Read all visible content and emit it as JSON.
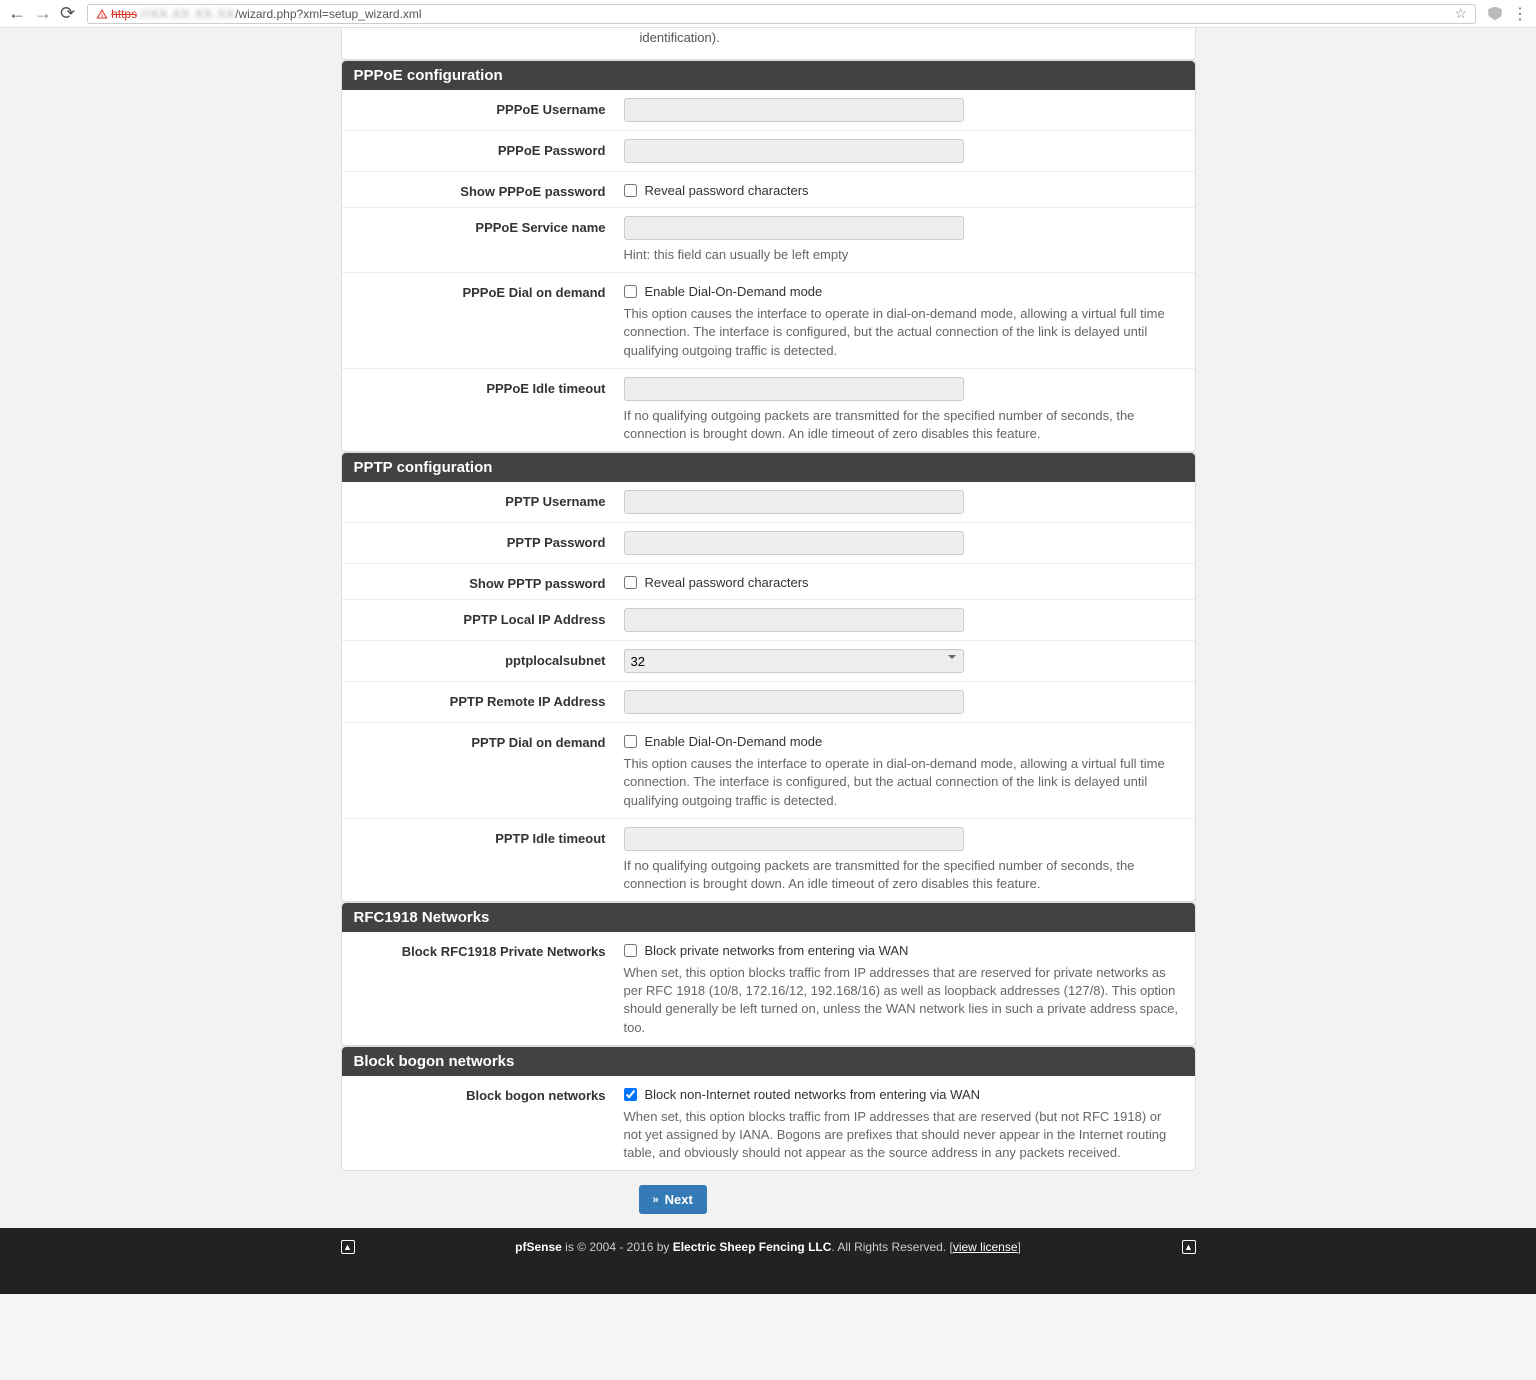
{
  "browser": {
    "url_prefix": "https",
    "url_host_blur": "://XX.XX.XX.XX",
    "url_path": "/wizard.php?xml=setup_wizard.xml"
  },
  "top_truncated": "identification).",
  "sections": {
    "pppoe": {
      "title": "PPPoE configuration",
      "username_label": "PPPoE Username",
      "password_label": "PPPoE Password",
      "show_pw_label": "Show PPPoE password",
      "show_pw_check": "Reveal password characters",
      "service_label": "PPPoE Service name",
      "service_hint": "Hint: this field can usually be left empty",
      "dial_label": "PPPoE Dial on demand",
      "dial_check": "Enable Dial-On-Demand mode",
      "dial_help": "This option causes the interface to operate in dial-on-demand mode, allowing a virtual full time connection. The interface is configured, but the actual connection of the link is delayed until qualifying outgoing traffic is detected.",
      "idle_label": "PPPoE Idle timeout",
      "idle_help": "If no qualifying outgoing packets are transmitted for the specified number of seconds, the connection is brought down. An idle timeout of zero disables this feature."
    },
    "pptp": {
      "title": "PPTP configuration",
      "username_label": "PPTP Username",
      "password_label": "PPTP Password",
      "show_pw_label": "Show PPTP password",
      "show_pw_check": "Reveal password characters",
      "localip_label": "PPTP Local IP Address",
      "subnet_label": "pptplocalsubnet",
      "subnet_value": "32",
      "remoteip_label": "PPTP Remote IP Address",
      "dial_label": "PPTP Dial on demand",
      "dial_check": "Enable Dial-On-Demand mode",
      "dial_help": "This option causes the interface to operate in dial-on-demand mode, allowing a virtual full time connection. The interface is configured, but the actual connection of the link is delayed until qualifying outgoing traffic is detected.",
      "idle_label": "PPTP Idle timeout",
      "idle_help": "If no qualifying outgoing packets are transmitted for the specified number of seconds, the connection is brought down. An idle timeout of zero disables this feature."
    },
    "rfc1918": {
      "title": "RFC1918 Networks",
      "label": "Block RFC1918 Private Networks",
      "check": "Block private networks from entering via WAN",
      "help": "When set, this option blocks traffic from IP addresses that are reserved for private networks as per RFC 1918 (10/8, 172.16/12, 192.168/16) as well as loopback addresses (127/8). This option should generally be left turned on, unless the WAN network lies in such a private address space, too."
    },
    "bogon": {
      "title": "Block bogon networks",
      "label": "Block bogon networks",
      "check": "Block non-Internet routed networks from entering via WAN",
      "help": "When set, this option blocks traffic from IP addresses that are reserved (but not RFC 1918) or not yet assigned by IANA. Bogons are prefixes that should never appear in the Internet routing table, and obviously should not appear as the source address in any packets received."
    }
  },
  "next_button": "Next",
  "footer": {
    "brand": "pfSense",
    "copyright_a": " is © 2004 - 2016 by ",
    "company": "Electric Sheep Fencing LLC",
    "copyright_b": ". All Rights Reserved. [",
    "license": "view license",
    "copyright_c": "]"
  }
}
